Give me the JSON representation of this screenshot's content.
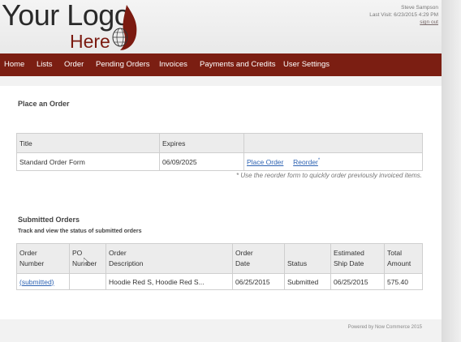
{
  "logo": {
    "line1": "Your Logo",
    "line2": "Here",
    "flame_color": "#7b1a10"
  },
  "user": {
    "name": "Steve Sampson",
    "last_visit": "Last Visit: 6/23/2015 4:29 PM",
    "sign_out": "sign out"
  },
  "nav": {
    "items": [
      "Home",
      "Lists",
      "Order",
      "Pending Orders",
      "Invoices",
      "Payments and Credits",
      "User Settings"
    ],
    "bar_color": "#7b1e12"
  },
  "place_order": {
    "heading": "Place an Order",
    "columns": [
      "Title",
      "Expires",
      ""
    ],
    "rows": [
      {
        "title": "Standard Order Form",
        "expires": "06/09/2025",
        "action1": "Place Order",
        "action2": "Reorder"
      }
    ],
    "note": "* Use the reorder form to quickly order previously invoiced items."
  },
  "submitted": {
    "heading": "Submitted Orders",
    "subheading": "Track and view the status of submitted orders",
    "columns": [
      {
        "l1": "Order",
        "l2": "Number"
      },
      {
        "l1": "PO",
        "l2": "Number"
      },
      {
        "l1": "Order",
        "l2": "Description"
      },
      {
        "l1": "Order",
        "l2": "Date"
      },
      {
        "l1": "",
        "l2": "Status"
      },
      {
        "l1": "Estimated",
        "l2": "Ship Date"
      },
      {
        "l1": "Total",
        "l2": "Amount"
      }
    ],
    "rows": [
      {
        "order_number": "(submitted)",
        "po_number": "",
        "description": "Hoodie Red S, Hoodie Red S...",
        "order_date": "06/25/2015",
        "status": "Submitted",
        "ship_date": "06/25/2015",
        "total": "575.40"
      }
    ]
  },
  "footer": "Powered by Now Commerce 2015"
}
